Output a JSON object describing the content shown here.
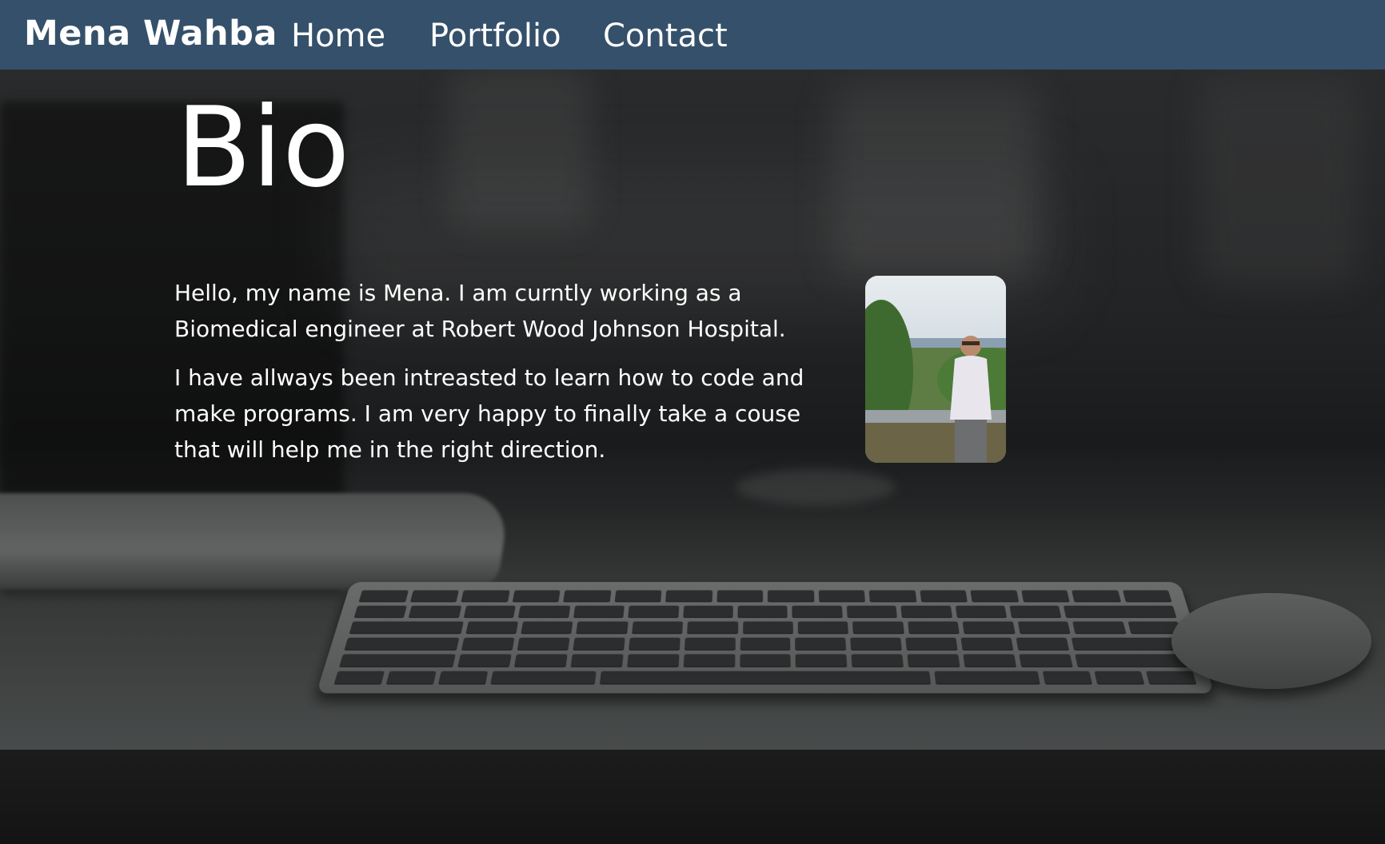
{
  "nav": {
    "brand": "Mena Wahba",
    "links": [
      {
        "label": "Home"
      },
      {
        "label": "Portfolio"
      },
      {
        "label": "Contact"
      }
    ]
  },
  "main": {
    "title": "Bio",
    "paragraphs": [
      "Hello, my name is Mena. I am curntly working as a Biomedical engineer at Robert Wood Johnson Hospital.",
      "I have allways been intreasted to learn how to code and make programs. I am very happy to finally take a couse that will help me in the right direction."
    ]
  },
  "colors": {
    "navbar": "#35506a",
    "text": "#ffffff",
    "background": "#232425"
  },
  "images": {
    "profile_photo": "profile-photo",
    "hero_background": "desk-keyboard-background"
  }
}
